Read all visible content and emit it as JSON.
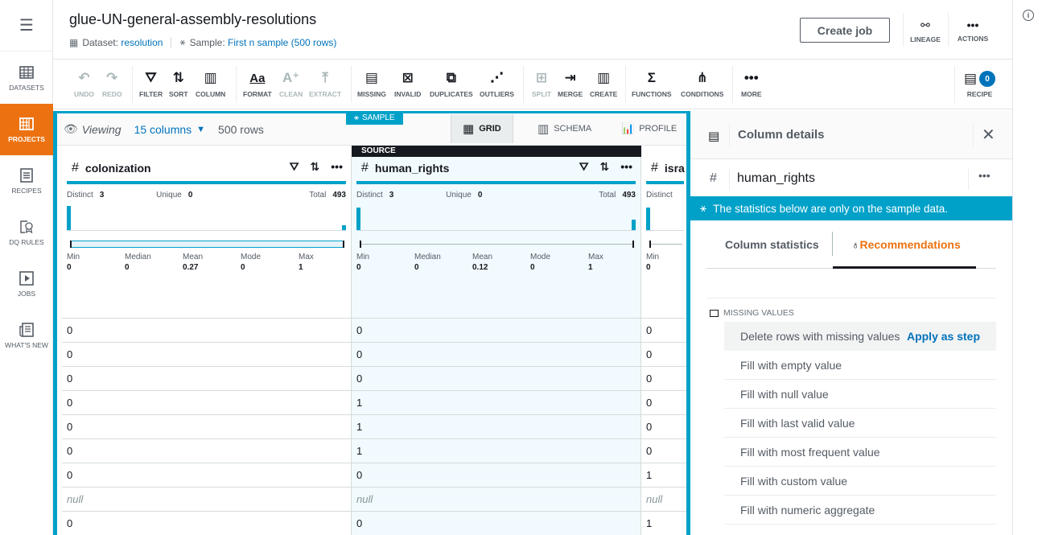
{
  "leftnav": {
    "menu_icon": "hamburger-icon",
    "items": [
      {
        "label": "DATASETS",
        "icon": "table-grid-icon",
        "active": false
      },
      {
        "label": "PROJECTS",
        "icon": "project-grid-icon",
        "active": true
      },
      {
        "label": "RECIPES",
        "icon": "recipe-list-icon",
        "active": false
      },
      {
        "label": "DQ RULES",
        "icon": "ribbon-badge-icon",
        "active": false
      },
      {
        "label": "JOBS",
        "icon": "play-icon",
        "active": false
      },
      {
        "label": "WHAT'S NEW",
        "icon": "newspaper-icon",
        "active": false
      }
    ]
  },
  "header": {
    "title": "glue-UN-general-assembly-resolutions",
    "dataset_label": "Dataset:",
    "dataset_value": "resolution",
    "sample_label": "Sample:",
    "sample_value": "First n sample (500 rows)",
    "create_job": "Create job",
    "lineage": "LINEAGE",
    "actions": "ACTIONS"
  },
  "toolbar": {
    "undo": "UNDO",
    "redo": "REDO",
    "filter": "FILTER",
    "sort": "SORT",
    "column": "COLUMN",
    "format": "FORMAT",
    "clean": "CLEAN",
    "extract": "EXTRACT",
    "missing": "MISSING",
    "invalid": "INVALID",
    "duplicates": "DUPLICATES",
    "outliers": "OUTLIERS",
    "split": "SPLIT",
    "merge": "MERGE",
    "create": "CREATE",
    "functions": "FUNCTIONS",
    "conditions": "CONDITIONS",
    "more": "MORE",
    "recipe": "RECIPE",
    "recipe_count": "0"
  },
  "grid": {
    "sample_tag": "SAMPLE",
    "viewing": "Viewing",
    "columns_selector": "15 columns",
    "rows": "500 rows",
    "view_tabs": {
      "grid": "GRID",
      "schema": "SCHEMA",
      "profile": "PROFILE"
    },
    "source_tag": "SOURCE",
    "stat_labels": {
      "distinct": "Distinct",
      "unique": "Unique",
      "total": "Total",
      "min": "Min",
      "median": "Median",
      "mean": "Mean",
      "mode": "Mode",
      "max": "Max"
    },
    "columns": [
      {
        "name": "colonization",
        "type_icon": "#",
        "distinct": "3",
        "unique": "0",
        "total": "493",
        "histogram": [
          0.6,
          0.12
        ],
        "min": "0",
        "median": "0",
        "mean": "0.27",
        "mode": "0",
        "max": "1",
        "rows": [
          "0",
          "0",
          "0",
          "0",
          "0",
          "0",
          "0",
          "null",
          "0"
        ]
      },
      {
        "name": "human_rights",
        "type_icon": "#",
        "distinct": "3",
        "unique": "0",
        "total": "493",
        "histogram": [
          0.55,
          0.25
        ],
        "min": "0",
        "median": "0",
        "mean": "0.12",
        "mode": "0",
        "max": "1",
        "rows": [
          "0",
          "0",
          "0",
          "1",
          "1",
          "1",
          "0",
          "null",
          "0"
        ]
      },
      {
        "name": "isra",
        "type_icon": "#",
        "distinct": "",
        "unique": "",
        "total": "",
        "histogram": [
          0.55
        ],
        "min": "0",
        "rows": [
          "0",
          "0",
          "0",
          "0",
          "0",
          "0",
          "1",
          "null",
          "1"
        ]
      }
    ]
  },
  "details": {
    "title": "Column details",
    "column_name": "human_rights",
    "notice": "The statistics below are only on the sample data.",
    "tabs": {
      "stats": "Column statistics",
      "recs": "Recommendations"
    },
    "section": "MISSING VALUES",
    "apply_label": "Apply as step",
    "recommendations": [
      "Delete rows with missing values",
      "Fill with empty value",
      "Fill with null value",
      "Fill with last valid value",
      "Fill with most frequent value",
      "Fill with custom value",
      "Fill with numeric aggregate"
    ]
  },
  "colors": {
    "accent": "#00a1c9",
    "active_nav": "#ec7211",
    "link": "#0073bb"
  }
}
